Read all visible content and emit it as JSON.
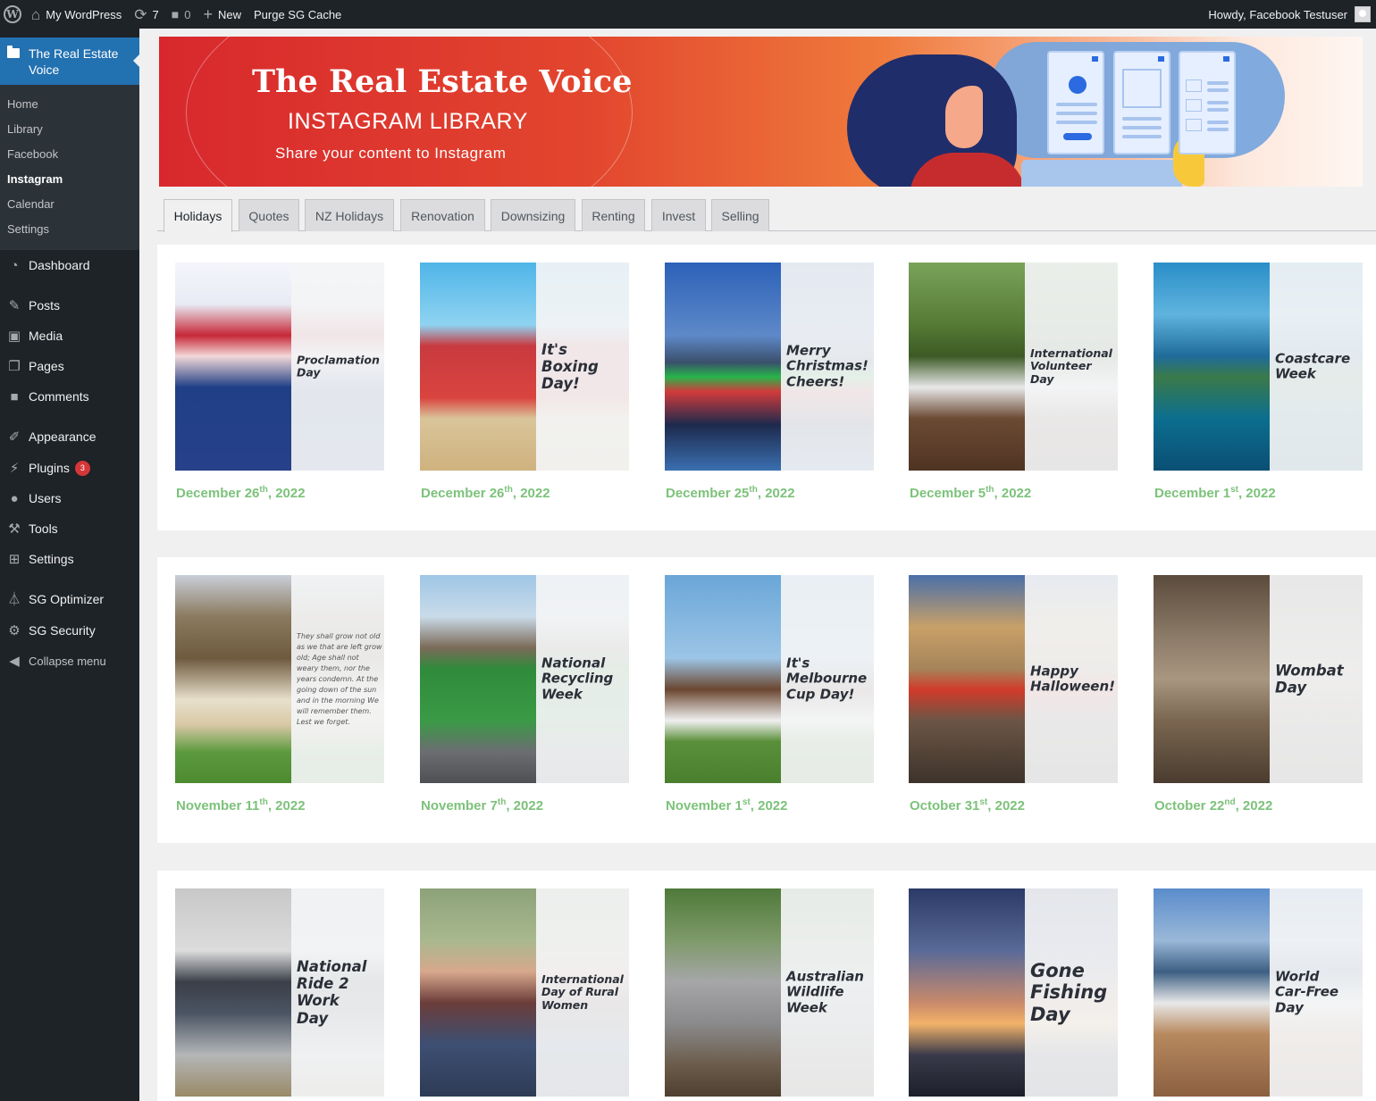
{
  "adminbar": {
    "site_name": "My WordPress",
    "updates_count": "7",
    "comments_count": "0",
    "new_label": "New",
    "purge_label": "Purge SG Cache",
    "howdy": "Howdy, Facebook Testuser"
  },
  "sidebar": {
    "plugin_title_line1": "The Real Estate",
    "plugin_title_line2": "Voice",
    "submenu": [
      "Home",
      "Library",
      "Facebook",
      "Instagram",
      "Calendar",
      "Settings"
    ],
    "current_submenu": "Instagram",
    "menu": {
      "dashboard": "Dashboard",
      "posts": "Posts",
      "media": "Media",
      "pages": "Pages",
      "comments": "Comments",
      "appearance": "Appearance",
      "plugins": "Plugins",
      "plugins_badge": "3",
      "users": "Users",
      "tools": "Tools",
      "settings": "Settings",
      "sg_optimizer": "SG Optimizer",
      "sg_security": "SG Security",
      "collapse": "Collapse menu"
    }
  },
  "banner": {
    "title": "The Real Estate Voice",
    "subtitle": "INSTAGRAM LIBRARY",
    "tagline": "Share your content to Instagram"
  },
  "tabs": [
    "Holidays",
    "Quotes",
    "NZ Holidays",
    "Renovation",
    "Downsizing",
    "Renting",
    "Invest",
    "Selling"
  ],
  "active_tab": "Holidays",
  "rows": [
    [
      {
        "caption": "Proclamation\nDay",
        "size": "s",
        "month": "December",
        "day": "26",
        "suffix": "th",
        "year": ", 2022",
        "photo": "linear-gradient(180deg,#f4f6fb 0%,#e8ebf4 20%,#c62838 35%,#f3d8d8 45%,#1f3f86 60%,#27418a 100%)"
      },
      {
        "caption": "It's\nBoxing\nDay!",
        "size": "l",
        "month": "December",
        "day": "26",
        "suffix": "th",
        "year": ", 2022",
        "photo": "linear-gradient(180deg,#4fb5e8 0%,#8fd3f1 30%,#c83a3f 40%,#d9443f 65%,#d9c59a 75%,#cfb27f 100%)"
      },
      {
        "caption": "Merry\nChristmas!\nCheers!",
        "size": "m",
        "month": "December",
        "day": "25",
        "suffix": "th",
        "year": ", 2022",
        "photo": "linear-gradient(180deg,#2c61b8 0%,#5e89c9 35%,#3a4f6b 48%,#27b54a 55%,#d23b3b 62%,#1d2a4d 78%,#3a6fb0 100%)"
      },
      {
        "caption": "International\nVolunteer\nDay",
        "size": "s",
        "month": "December",
        "day": "5",
        "suffix": "th",
        "year": ", 2022",
        "photo": "linear-gradient(180deg,#7aa35a 0%,#557a35 30%,#3c5a25 45%,#e8e8ea 60%,#6b4a33 75%,#4f3423 100%)"
      },
      {
        "caption": "Coastcare\nWeek",
        "size": "m",
        "month": "December",
        "day": "1",
        "suffix": "st",
        "year": ", 2022",
        "photo": "linear-gradient(180deg,#2a8ec8 0%,#5fb4de 25%,#1f6b9a 45%,#3a7a4a 55%,#0c6e8f 75%,#0a4f74 100%)"
      }
    ],
    [
      {
        "caption": "They shall grow not old as we that are left grow old; Age shall not weary them, nor the years condemn. At the going down of the sun and in the morning We will remember them. Lest we forget.",
        "size": "poem",
        "month": "November",
        "day": "11",
        "suffix": "th",
        "year": ", 2022",
        "photo": "linear-gradient(180deg,#c9cfd8 0%,#8a7a5f 20%,#6e5a3f 40%,#e8e0cc 60%,#d8c8a5 72%,#5d9a3f 85%,#4d8a30 100%)"
      },
      {
        "caption": "National\nRecycling\nWeek",
        "size": "m",
        "month": "November",
        "day": "7",
        "suffix": "th",
        "year": ", 2022",
        "photo": "linear-gradient(180deg,#9fc6e6 0%,#c9dbe9 20%,#7b6a58 35%,#2f8b3b 45%,#3a9a45 70%,#6b6d71 85%,#4e5054 100%)"
      },
      {
        "caption": "It's\nMelbourne\nCup Day!",
        "size": "m",
        "month": "November",
        "day": "1",
        "suffix": "st",
        "year": ", 2022",
        "photo": "linear-gradient(180deg,#6aa6d8 0%,#9cc5e6 40%,#6b4630 55%,#f0f0f0 70%,#5a8f3a 80%,#4a7f2e 100%)"
      },
      {
        "caption": "Happy\nHalloween!",
        "size": "m",
        "month": "October",
        "day": "31",
        "suffix": "st",
        "year": ", 2022",
        "photo": "linear-gradient(180deg,#4b6fa8 0%,#c8a068 25%,#a6845a 45%,#d13b2a 55%,#6b5545 70%,#3d332b 100%)"
      },
      {
        "caption": "Wombat\nDay",
        "size": "l",
        "month": "October",
        "day": "22",
        "suffix": "nd",
        "year": ", 2022",
        "photo": "linear-gradient(180deg,#5b4b3c 0%,#8c7b68 30%,#a89680 50%,#7a6650 70%,#4a3c2f 100%)"
      }
    ],
    [
      {
        "caption": "National\nRide 2\nWork\nDay",
        "size": "l",
        "month": "",
        "day": "",
        "suffix": "",
        "year": "",
        "photo": "linear-gradient(180deg,#c8c8c8 0%,#dcdcdc 30%,#3a3f48 45%,#4b5563 60%,#b4b6b8 80%,#9a8a66 100%)"
      },
      {
        "caption": "International\nDay of Rural\nWomen",
        "size": "s",
        "month": "",
        "day": "",
        "suffix": "",
        "year": "",
        "photo": "linear-gradient(180deg,#8da27a 0%,#a9b88e 25%,#d7a88c 40%,#6b3d3a 55%,#3d4f73 75%,#2e3b55 100%)"
      },
      {
        "caption": "Australian\nWildlife\nWeek",
        "size": "m",
        "month": "",
        "day": "",
        "suffix": "",
        "year": "",
        "photo": "linear-gradient(180deg,#4f7a3a 0%,#7e9a6a 25%,#a6a6a8 45%,#8a8a8c 65%,#6b5b4a 85%,#4f3f30 100%)"
      },
      {
        "caption": "Gone\nFishing\nDay",
        "size": "xl",
        "month": "",
        "day": "",
        "suffix": "",
        "year": "",
        "photo": "linear-gradient(180deg,#2b3a66 0%,#5a6a98 30%,#c98a6a 55%,#f2b26a 65%,#3a3a4a 80%,#1c1f2b 100%)"
      },
      {
        "caption": "World\nCar-Free\nDay",
        "size": "m",
        "month": "",
        "day": "",
        "suffix": "",
        "year": "",
        "photo": "linear-gradient(180deg,#5a8ccc 0%,#9ab8d8 25%,#3c5f83 40%,#e8e8e8 55%,#b8895f 70%,#8a6040 100%)"
      }
    ]
  ],
  "colors": {
    "admin_dark": "#1d2327",
    "admin_accent": "#2271b1",
    "date_green": "#7cc27a"
  }
}
